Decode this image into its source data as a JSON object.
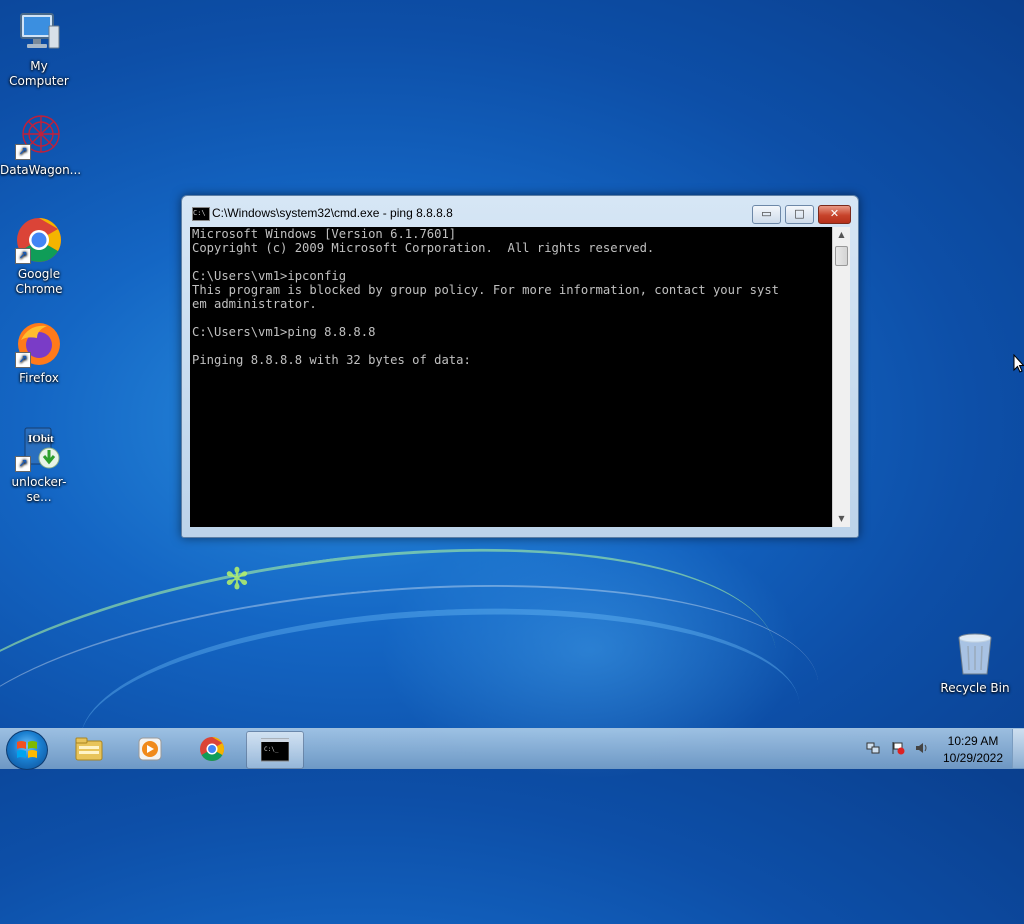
{
  "desktop": {
    "icons": [
      {
        "label": "My Computer",
        "icon": "computer-icon"
      },
      {
        "label": "DataWagon...",
        "icon": "datawagon-icon"
      },
      {
        "label": "Google Chrome",
        "icon": "chrome-icon"
      },
      {
        "label": "Firefox",
        "icon": "firefox-icon"
      },
      {
        "label": "unlocker-se...",
        "icon": "iobit-unlocker-icon"
      },
      {
        "label": "Recycle Bin",
        "icon": "recycle-bin-icon"
      }
    ]
  },
  "cmd_window": {
    "title": "C:\\Windows\\system32\\cmd.exe - ping  8.8.8.8",
    "lines": [
      "Microsoft Windows [Version 6.1.7601]",
      "Copyright (c) 2009 Microsoft Corporation.  All rights reserved.",
      "",
      "C:\\Users\\vm1>ipconfig",
      "This program is blocked by group policy. For more information, contact your syst",
      "em administrator.",
      "",
      "C:\\Users\\vm1>ping 8.8.8.8",
      "",
      "Pinging 8.8.8.8 with 32 bytes of data:"
    ],
    "buttons": {
      "minimize": "▭",
      "maximize": "□",
      "close": "✕"
    }
  },
  "taskbar": {
    "start_icon": "windows-logo-icon",
    "pinned": [
      "explorer-icon",
      "media-player-icon",
      "chrome-icon",
      "cmd-icon"
    ],
    "tray": [
      "network-icon",
      "action-center-flag-icon",
      "volume-icon"
    ],
    "clock_time": "10:29 AM",
    "clock_date": "10/29/2022"
  }
}
